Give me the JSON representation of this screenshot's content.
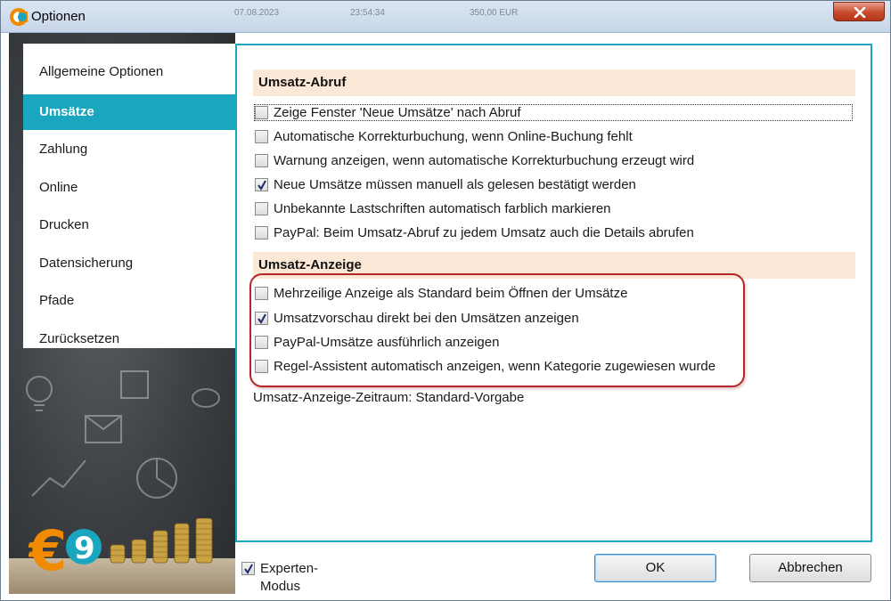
{
  "window": {
    "title": "Optionen",
    "background_row": [
      "07.08.2023",
      "23:54:34",
      "350,00 EUR"
    ]
  },
  "sidebar": {
    "items": [
      {
        "label": "Allgemeine Optionen",
        "active": false
      },
      {
        "label": "Umsätze",
        "active": true
      },
      {
        "label": "Zahlung",
        "active": false
      },
      {
        "label": "Online",
        "active": false
      },
      {
        "label": "Drucken",
        "active": false
      },
      {
        "label": "Datensicherung",
        "active": false
      },
      {
        "label": "Pfade",
        "active": false
      },
      {
        "label": "Zurücksetzen",
        "active": false
      }
    ],
    "logo_text": "€9"
  },
  "sections": {
    "abruf": {
      "title": "Umsatz-Abruf",
      "options": [
        {
          "label": "Zeige Fenster 'Neue Umsätze' nach Abruf",
          "checked": false
        },
        {
          "label": "Automatische Korrekturbuchung, wenn Online-Buchung fehlt",
          "checked": false
        },
        {
          "label": "Warnung anzeigen, wenn automatische Korrekturbuchung erzeugt wird",
          "checked": false
        },
        {
          "label": "Neue Umsätze müssen manuell als gelesen bestätigt werden",
          "checked": true
        },
        {
          "label": "Unbekannte Lastschriften automatisch farblich markieren",
          "checked": false
        },
        {
          "label": "PayPal: Beim Umsatz-Abruf zu jedem Umsatz auch die Details abrufen",
          "checked": false
        }
      ]
    },
    "anzeige": {
      "title": "Umsatz-Anzeige",
      "options": [
        {
          "label": "Mehrzeilige Anzeige als Standard beim Öffnen der Umsätze",
          "checked": false
        },
        {
          "label": "Umsatzvorschau direkt bei den Umsätzen anzeigen",
          "checked": true
        },
        {
          "label": "PayPal-Umsätze ausführlich anzeigen",
          "checked": false
        },
        {
          "label": "Regel-Assistent automatisch anzeigen, wenn Kategorie zugewiesen wurde",
          "checked": false
        }
      ],
      "period_label": "Umsatz-Anzeige-Zeitraum: Standard-Vorgabe"
    }
  },
  "footer": {
    "expert_mode": {
      "label": "Experten-Modus",
      "checked": true
    },
    "ok_label": "OK",
    "cancel_label": "Abbrechen"
  },
  "colors": {
    "accent": "#1aa6bf",
    "section_bg": "#fbe8d6",
    "highlight_border": "#b52727"
  }
}
